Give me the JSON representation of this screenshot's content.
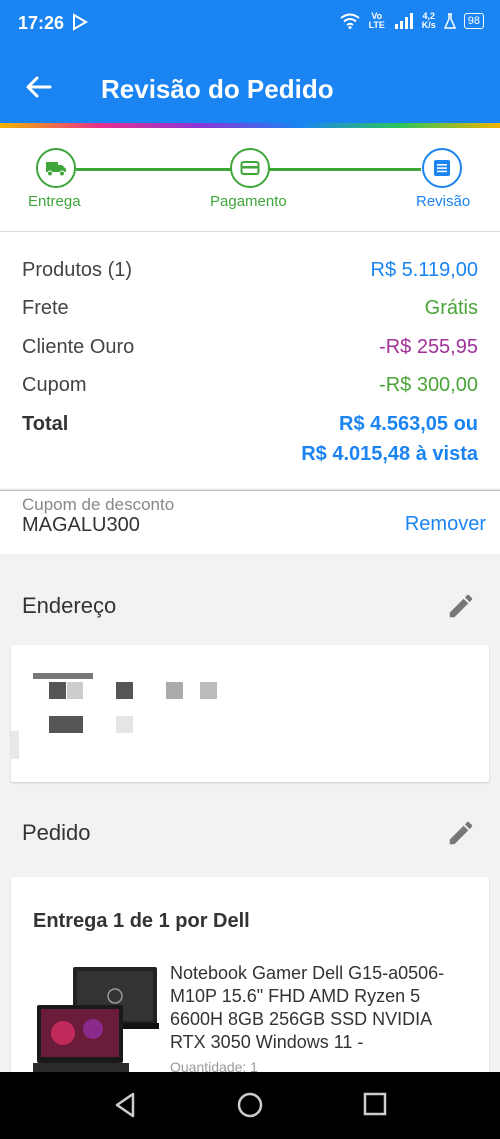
{
  "status_bar": {
    "time": "17:26",
    "network": "Vo LTE",
    "speed_value": "4,2",
    "speed_unit": "K/s",
    "battery": "98"
  },
  "app_bar": {
    "title": "Revisão do Pedido"
  },
  "steps": [
    {
      "label": "Entrega"
    },
    {
      "label": "Pagamento"
    },
    {
      "label": "Revisão"
    }
  ],
  "summary": {
    "products_label": "Produtos (1)",
    "products_value": "R$ 5.119,00",
    "shipping_label": "Frete",
    "shipping_value": "Grátis",
    "gold_label": "Cliente Ouro",
    "gold_value": "-R$ 255,95",
    "coupon_label": "Cupom",
    "coupon_value": "-R$ 300,00",
    "total_label": "Total",
    "total_value": "R$ 4.563,05 ou",
    "total_cash": "R$ 4.015,48 à vista"
  },
  "coupon": {
    "caption": "Cupom de desconto",
    "code": "MAGALU300",
    "remove": "Remover"
  },
  "address": {
    "title": "Endereço"
  },
  "order": {
    "title": "Pedido",
    "delivery": "Entrega 1 de 1 por Dell",
    "product_name": "Notebook Gamer Dell G15-a0506-M10P 15.6\" FHD AMD Ryzen 5 6600H 8GB 256GB SSD NVIDIA RTX 3050 Windows 11 -",
    "quantity": "Quantidade: 1"
  },
  "colors": {
    "primary": "#1a84f2",
    "green": "#3fa63a",
    "purple": "#a0309a"
  }
}
